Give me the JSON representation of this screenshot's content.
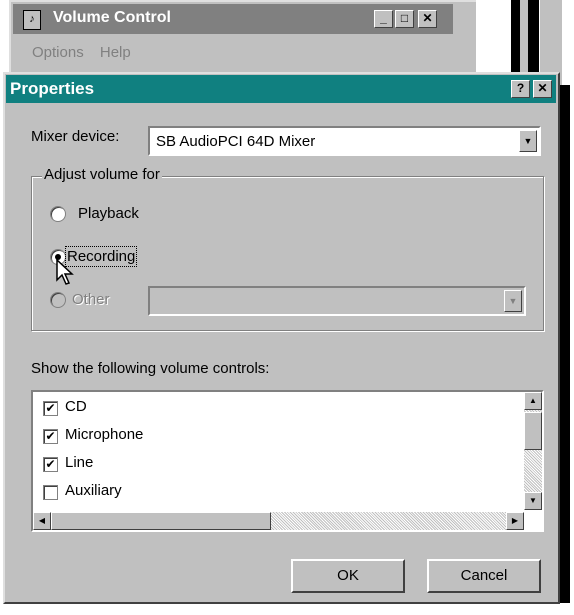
{
  "bg_window": {
    "title": "Volume Control",
    "menu": [
      "Options",
      "Help"
    ],
    "min_symbol": "_",
    "max_symbol": "□",
    "close_symbol": "✕"
  },
  "dialog": {
    "title": "Properties",
    "help_symbol": "?",
    "close_symbol": "✕",
    "mixer_label": "Mixer device:",
    "mixer_value": "SB AudioPCI 64D Mixer",
    "group_label": "Adjust volume for",
    "radios": {
      "playback": "Playback",
      "recording": "Recording",
      "other": "Other"
    },
    "selected": "Recording",
    "controls_label": "Show the following volume controls:",
    "controls": [
      {
        "label": "CD",
        "checked": true
      },
      {
        "label": "Microphone",
        "checked": true
      },
      {
        "label": "Line",
        "checked": true
      },
      {
        "label": "Auxiliary",
        "checked": false
      }
    ],
    "check_mark": "✔",
    "ok": "OK",
    "cancel": "Cancel"
  },
  "colors": {
    "titlebar": "#108080",
    "face": "#c0c0c0",
    "inactive_title": "#808080"
  }
}
